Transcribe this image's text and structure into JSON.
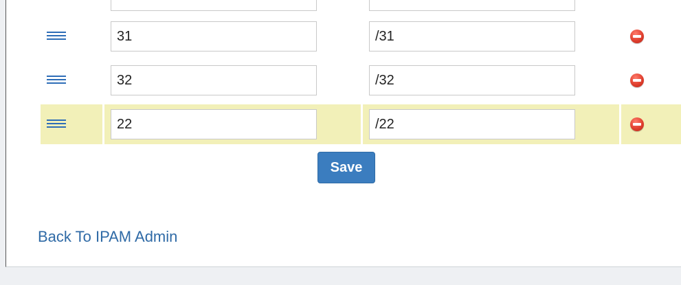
{
  "rows": [
    {
      "value": "",
      "prefix": ""
    },
    {
      "value": "31",
      "prefix": "/31"
    },
    {
      "value": "32",
      "prefix": "/32"
    },
    {
      "value": "22",
      "prefix": "/22",
      "highlighted": true
    }
  ],
  "save_label": "Save",
  "back_link_label": "Back To IPAM Admin",
  "colors": {
    "highlight": "#f2f0b8",
    "accent": "#2d6db7",
    "button": "#3b7dbf",
    "remove": "#e0402f"
  }
}
